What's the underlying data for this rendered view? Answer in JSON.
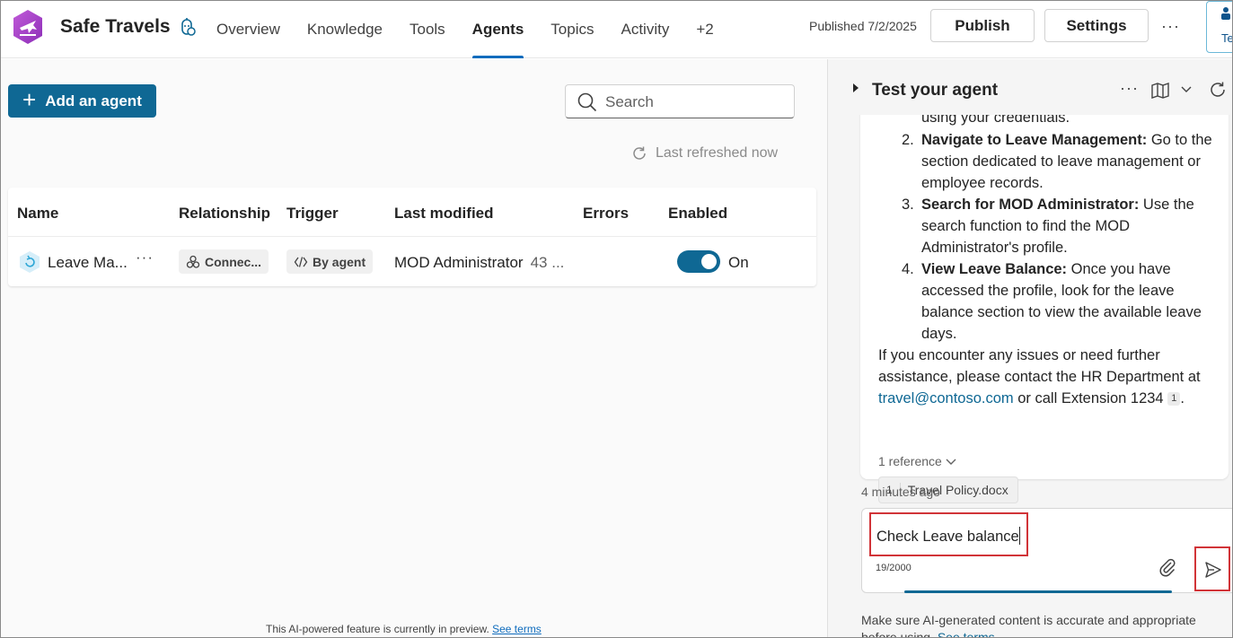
{
  "header": {
    "app_title": "Safe Travels",
    "nav": [
      "Overview",
      "Knowledge",
      "Tools",
      "Agents",
      "Topics",
      "Activity",
      "+2"
    ],
    "active_nav": "Agents",
    "published": "Published 7/2/2025",
    "publish_label": "Publish",
    "settings_label": "Settings",
    "more_icon": "more-horizontal-icon",
    "edge_button_label": "Te"
  },
  "agents_pane": {
    "add_agent_label": "Add an agent",
    "search_placeholder": "Search",
    "last_refreshed": "Last refreshed now",
    "columns": [
      "Name",
      "Relationship",
      "Trigger",
      "Last modified",
      "Errors",
      "Enabled"
    ],
    "rows": [
      {
        "name": "Leave Ma...",
        "relationship": "Connec...",
        "trigger": "By agent",
        "last_modified_by": "MOD Administrator",
        "last_modified_when": "43 ...",
        "errors": "",
        "enabled": true,
        "enabled_label": "On"
      }
    ],
    "preview_note": "This AI-powered feature is currently in preview.",
    "see_terms": "See terms"
  },
  "test_pane": {
    "title": "Test your agent",
    "message": {
      "partial_line": "using your credentials.",
      "steps": [
        {
          "num": "2.",
          "bold": "Navigate to Leave Management:",
          "text": " Go to the section dedicated to leave management or employee records."
        },
        {
          "num": "3.",
          "bold": "Search for MOD Administrator:",
          "text": " Use the search function to find the MOD Administrator's profile."
        },
        {
          "num": "4.",
          "bold": "View Leave Balance:",
          "text": " Once you have accessed the profile, look for the leave balance section to view the available leave days."
        }
      ],
      "closing_pre": "If you encounter any issues or need further assistance, please contact the HR Department at",
      "email": "travel@contoso.com",
      "closing_post": "or call Extension 1234",
      "citation": "1",
      "closing_end": ".",
      "reference_toggle": "1 reference",
      "reference_num": "1",
      "reference_label": "Travel Policy.docx"
    },
    "timestamp": "4 minutes ago",
    "composer": {
      "value": "Check Leave balance",
      "counter": "19/2000"
    },
    "disclaimer": "Make sure AI-generated content is accurate and appropriate before using.",
    "see_terms": "See terms"
  },
  "colors": {
    "accent": "#0f6894",
    "highlight": "#d13438",
    "logo": "#b43ccf"
  }
}
